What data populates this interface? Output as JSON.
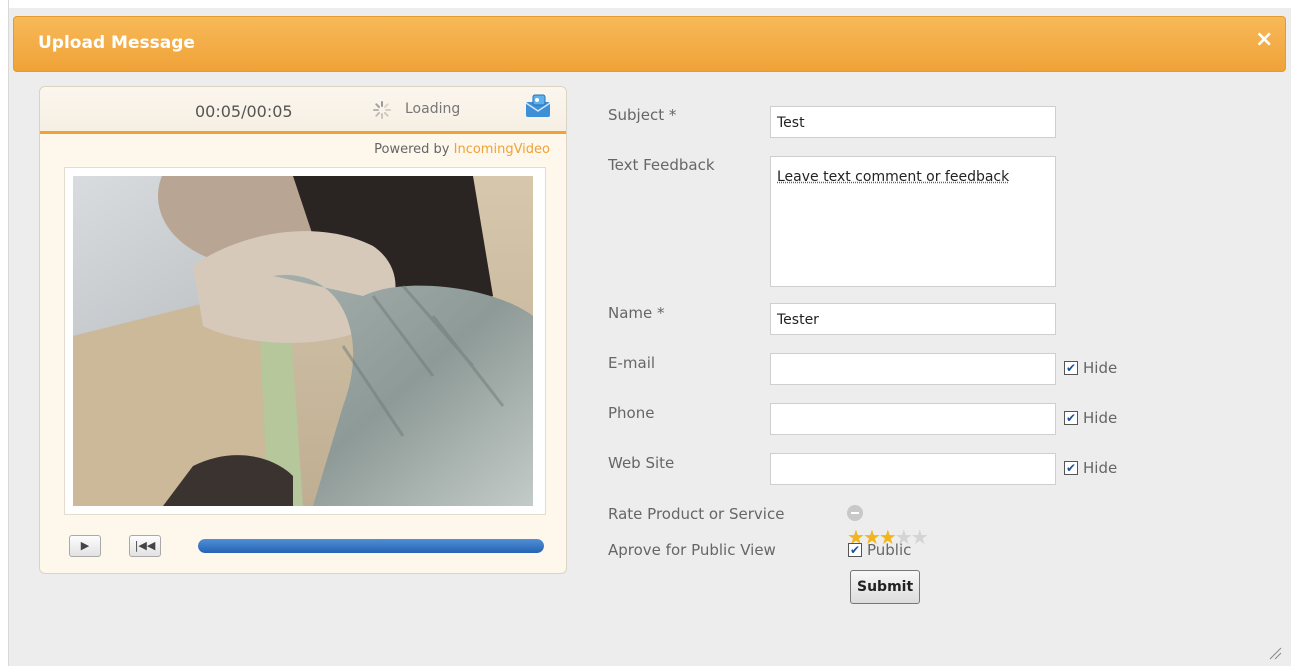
{
  "dialog": {
    "title": "Upload Message",
    "close": "×"
  },
  "player": {
    "time": "00:05/00:05",
    "loading": "Loading",
    "powered_by_prefix": "Powered by ",
    "powered_by_brand": "IncomingVideo",
    "play_symbol": "▶",
    "rewind_symbol": "|◀◀",
    "progress_fraction": 1.0
  },
  "form": {
    "subject_label": "Subject *",
    "subject_value": "Test",
    "feedback_label": "Text Feedback",
    "feedback_value": "Leave text comment or feedback",
    "name_label": "Name *",
    "name_value": "Tester",
    "email_label": "E-mail",
    "email_value": "",
    "phone_label": "Phone",
    "phone_value": "",
    "website_label": "Web Site",
    "website_value": "",
    "hide_label": "Hide",
    "rating_label": "Rate Product or Service",
    "rating_value": 3,
    "rating_max": 5,
    "public_view_label": "Aprove for Public View",
    "public_label": "Public",
    "check_mark": "✔",
    "submit_label": "Submit"
  },
  "colors": {
    "accent": "#f0a238",
    "progress": "#2563b3",
    "star": "#f2b51f"
  }
}
